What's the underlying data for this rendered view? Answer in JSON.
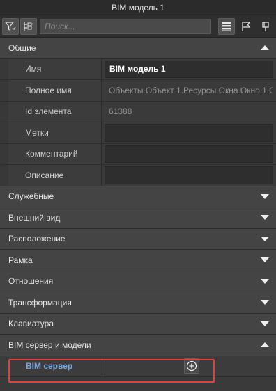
{
  "window": {
    "title": "BIM модель 1"
  },
  "toolbar": {
    "search_placeholder": "Поиск...",
    "icons": [
      "filter-icon",
      "tree-filter-icon",
      "list-view-icon",
      "flag-icon",
      "pin-icon"
    ]
  },
  "groups": {
    "general": {
      "label": "Общие",
      "rows": [
        {
          "label": "Имя",
          "value": "BIM модель 1"
        },
        {
          "label": "Полное имя",
          "value": "Объекты.Объект 1.Ресурсы.Окна.Окно 1.С"
        },
        {
          "label": "Id элемента",
          "value": "61388"
        },
        {
          "label": "Метки",
          "value": ""
        },
        {
          "label": "Комментарий",
          "value": ""
        },
        {
          "label": "Описание",
          "value": ""
        }
      ]
    },
    "collapsed": [
      {
        "label": "Служебные"
      },
      {
        "label": "Внешний вид"
      },
      {
        "label": "Расположение"
      },
      {
        "label": "Рамка"
      },
      {
        "label": "Отношения"
      },
      {
        "label": "Трансформация"
      },
      {
        "label": "Клавиатура"
      }
    ],
    "bim_server": {
      "label": "BIM сервер и модели",
      "row_label": "BIM сервер"
    }
  },
  "colors": {
    "accent_blue": "#7aa7de",
    "highlight_red": "#e04040"
  }
}
